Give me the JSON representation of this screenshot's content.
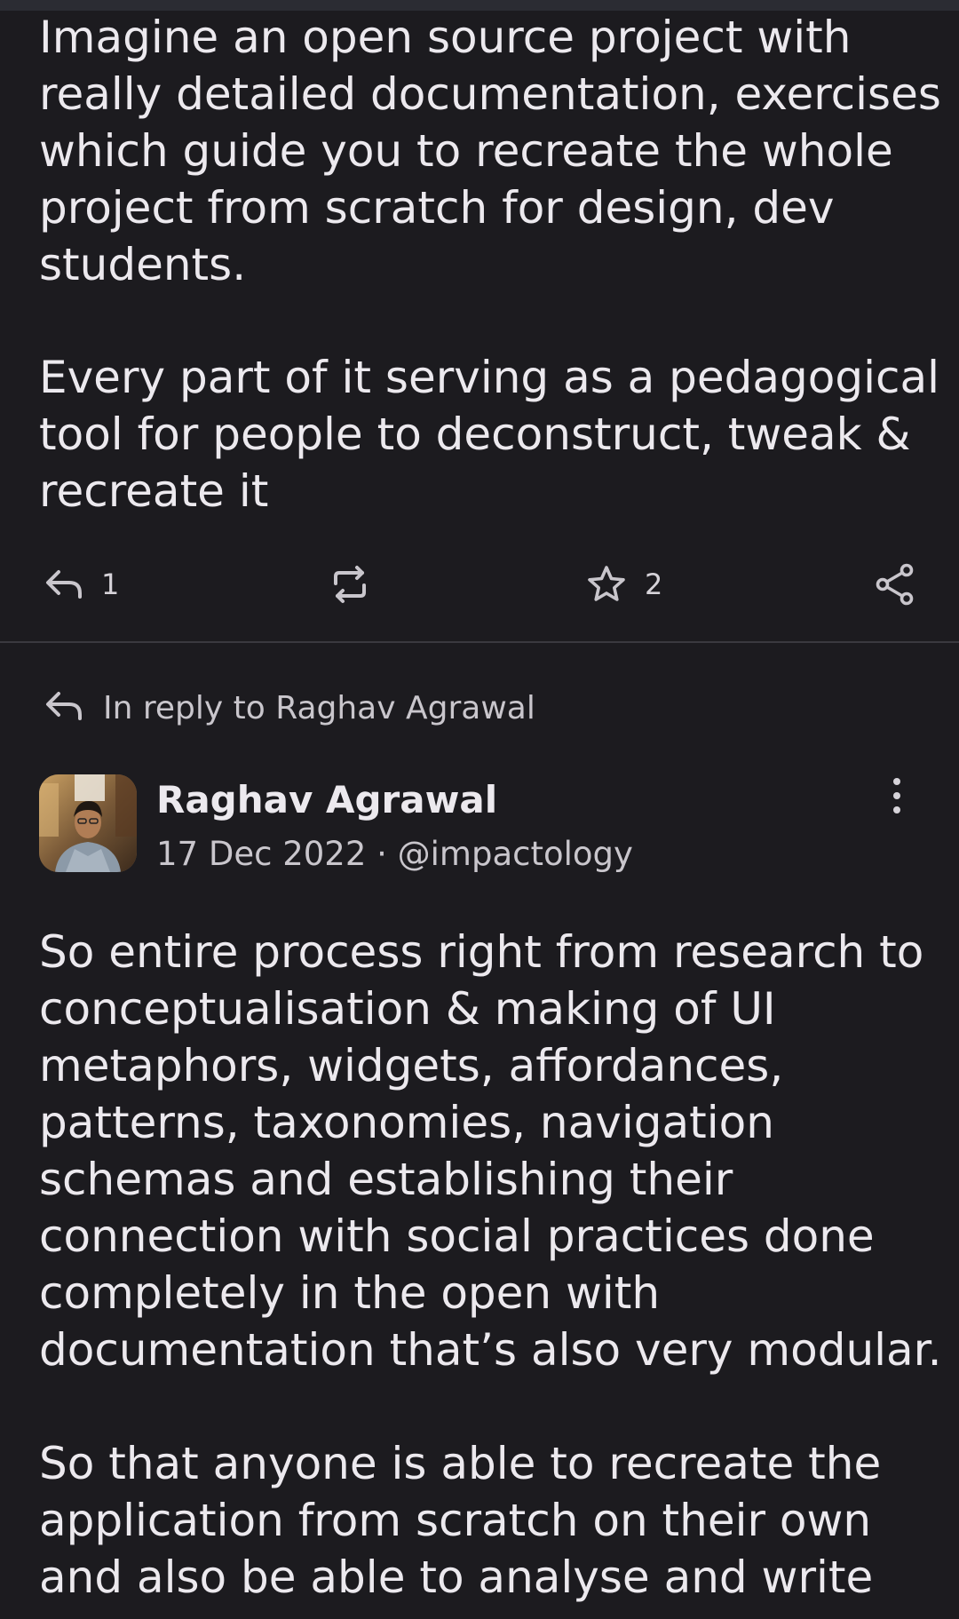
{
  "post": {
    "paragraph1": [
      "Imagine an open source project with",
      "really detailed documentation, exercises",
      "which guide you to recreate the whole",
      "project from scratch for design, dev",
      "students."
    ],
    "paragraph2": [
      "Every part of it serving as a pedagogical",
      "tool for people to deconstruct, tweak &",
      "recreate it"
    ],
    "actions": {
      "reply_icon": "reply-icon",
      "reply_count": "1",
      "repost_icon": "repost-icon",
      "star_icon": "star-icon",
      "star_count": "2",
      "share_icon": "share-icon"
    }
  },
  "reply_context": {
    "icon": "reply-icon",
    "label": "In reply to Raghav Agrawal"
  },
  "reply_post": {
    "author_name": "Raghav Agrawal",
    "date": "17 Dec 2022",
    "separator": "·",
    "handle": "@impactology",
    "meta": "17 Dec 2022 · @impactology",
    "more_icon": "more-vertical-icon",
    "paragraph1": [
      "So entire process right from research to",
      "conceptualisation & making of UI",
      "metaphors, widgets, affordances,",
      "patterns, taxonomies, navigation",
      "schemas and establishing their",
      "connection with social practices done",
      "completely in the open with",
      "documentation that’s also very modular."
    ],
    "paragraph2": [
      "So that anyone is able to recreate the",
      "application from scratch on their own",
      "and also be able to analyse and write"
    ]
  },
  "colors": {
    "background": "#1c1b1f",
    "text": "#ece9ee",
    "secondary_text": "#c9c6cc",
    "divider": "#3a393f"
  }
}
